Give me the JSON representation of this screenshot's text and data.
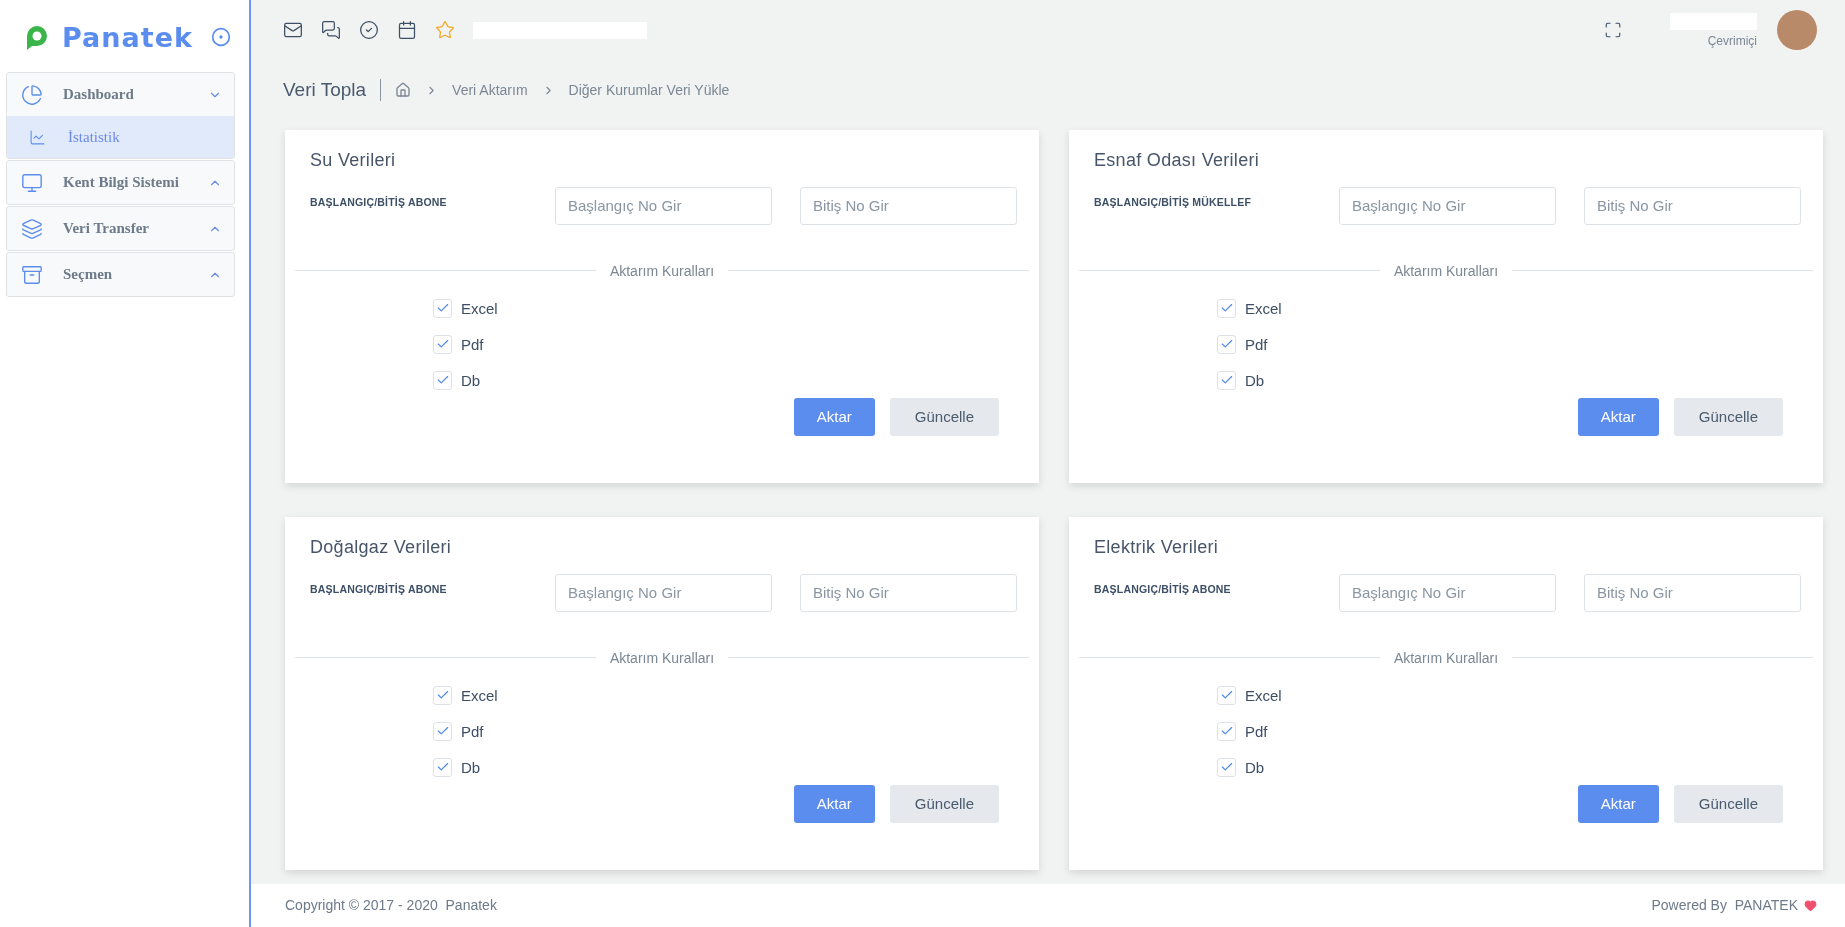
{
  "brand": {
    "name": "Panatek"
  },
  "sidebar": {
    "items": [
      {
        "label": "Dashboard",
        "expanded": true,
        "children": [
          {
            "label": "İstatistik",
            "selected": true
          }
        ]
      },
      {
        "label": "Kent Bilgi Sistemi",
        "expanded": false
      },
      {
        "label": "Veri Transfer",
        "expanded": false
      },
      {
        "label": "Seçmen",
        "expanded": false
      }
    ]
  },
  "topbar": {
    "status": "Çevrimiçi"
  },
  "page": {
    "title": "Veri Topla",
    "breadcrumb": [
      "Veri Aktarım",
      "Diğer Kurumlar Veri Yükle"
    ]
  },
  "cards": [
    {
      "title": "Su Verileri",
      "field_label": "BAŞLANGIÇ/BİTİŞ ABONE",
      "start_placeholder": "Başlangıç No Gir",
      "end_placeholder": "Bitiş No Gir",
      "rules_title": "Aktarım Kuralları",
      "rules": [
        {
          "label": "Excel",
          "checked": true
        },
        {
          "label": "Pdf",
          "checked": true
        },
        {
          "label": "Db",
          "checked": true
        }
      ],
      "buttons": [
        {
          "label": "Aktar",
          "kind": "primary"
        },
        {
          "label": "Güncelle",
          "kind": "secondary"
        }
      ]
    },
    {
      "title": "Esnaf Odası Verileri",
      "field_label": "BAŞLANGIÇ/BİTİŞ MÜKELLEF",
      "start_placeholder": "Başlangıç No Gir",
      "end_placeholder": "Bitiş No Gir",
      "rules_title": "Aktarım Kuralları",
      "rules": [
        {
          "label": "Excel",
          "checked": true
        },
        {
          "label": "Pdf",
          "checked": true
        },
        {
          "label": "Db",
          "checked": true
        }
      ],
      "buttons": [
        {
          "label": "Aktar",
          "kind": "primary"
        },
        {
          "label": "Güncelle",
          "kind": "secondary"
        }
      ]
    },
    {
      "title": "Doğalgaz Verileri",
      "field_label": "BAŞLANGIÇ/BİTİŞ ABONE",
      "start_placeholder": "Başlangıç No Gir",
      "end_placeholder": "Bitiş No Gir",
      "rules_title": "Aktarım Kuralları",
      "rules": [
        {
          "label": "Excel",
          "checked": true
        },
        {
          "label": "Pdf",
          "checked": true
        },
        {
          "label": "Db",
          "checked": true
        }
      ],
      "buttons": [
        {
          "label": "Aktar",
          "kind": "primary"
        },
        {
          "label": "Güncelle",
          "kind": "secondary"
        }
      ]
    },
    {
      "title": "Elektrik Verileri",
      "field_label": "BAŞLANGIÇ/BİTİŞ ABONE",
      "start_placeholder": "Başlangıç No Gir",
      "end_placeholder": "Bitiş No Gir",
      "rules_title": "Aktarım Kuralları",
      "rules": [
        {
          "label": "Excel",
          "checked": true
        },
        {
          "label": "Pdf",
          "checked": true
        },
        {
          "label": "Db",
          "checked": true
        }
      ],
      "buttons": [
        {
          "label": "Aktar",
          "kind": "primary"
        },
        {
          "label": "Güncelle",
          "kind": "secondary"
        }
      ]
    }
  ],
  "footer": {
    "copyright": "Copyright © 2017 - 2020  Panatek",
    "powered": "Powered By  PANATEK"
  }
}
